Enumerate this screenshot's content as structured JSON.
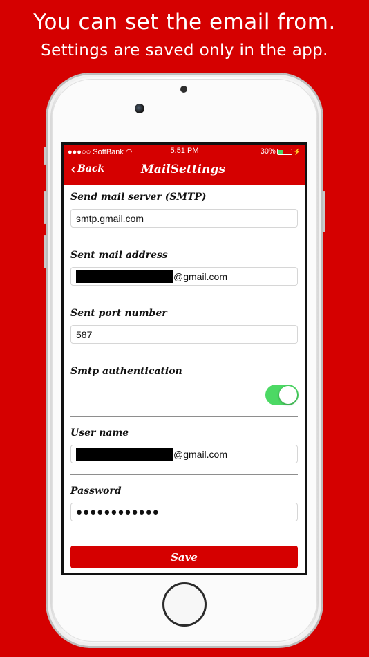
{
  "headline": {
    "line1": "You can set the email from.",
    "line2": "Settings are saved only in the app."
  },
  "status_bar": {
    "carrier": "●●●○○ SoftBank",
    "time": "5:51 PM",
    "battery": "30%"
  },
  "nav": {
    "back_label": "Back",
    "title": "MailSettings"
  },
  "form": {
    "smtp_label": "Send mail server (SMTP)",
    "smtp_value": "smtp.gmail.com",
    "address_label": "Sent mail address",
    "address_value": "@gmail.com",
    "port_label": "Sent port number",
    "port_value": "587",
    "auth_label": "Smtp authentication",
    "auth_enabled": true,
    "username_label": "User name",
    "username_value": "@gmail.com",
    "password_label": "Password",
    "password_value": "●●●●●●●●●●●●",
    "save_label": "Save"
  },
  "colors": {
    "brand_red": "#d50000",
    "toggle_on": "#4cd964"
  }
}
